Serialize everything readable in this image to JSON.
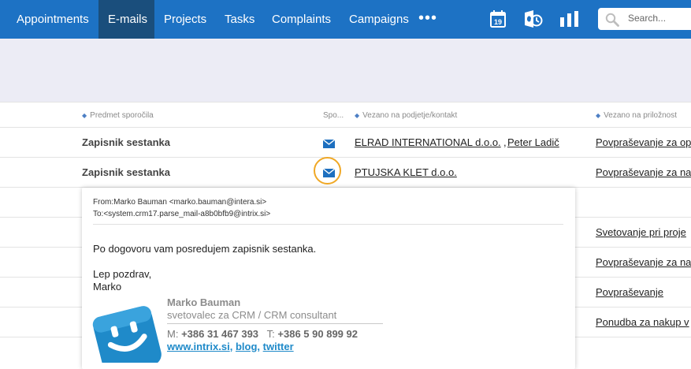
{
  "nav": {
    "items": [
      {
        "label": "Appointments"
      },
      {
        "label": "E-mails",
        "active": true
      },
      {
        "label": "Projects"
      },
      {
        "label": "Tasks"
      },
      {
        "label": "Complaints"
      },
      {
        "label": "Campaigns"
      }
    ],
    "more": "•••",
    "calendar_day": "19",
    "icons": [
      "more-dots-icon",
      "calendar-icon",
      "outlook-sync-icon",
      "bar-chart-icon",
      "search-icon"
    ]
  },
  "search": {
    "placeholder": "Search..."
  },
  "colors": {
    "topbar": "#1d72c4",
    "active_tab": "#1a4e7c",
    "highlight_ring": "#f0a825",
    "link_blue": "#1f8ac9",
    "envelope": "#1d6fbf"
  },
  "table": {
    "headers": {
      "subject": "Predmet sporočila",
      "sent": "Spo...",
      "related": "Vezano na podjetje/kontakt",
      "opportunity": "Vezano na priložnost"
    },
    "rows": [
      {
        "subject": "Zapisnik sestanka",
        "company": "ELRAD INTERNATIONAL d.o.o.",
        "sep": ",",
        "contact": "Peter Ladič",
        "opportunity": "Povpraševanje za op"
      },
      {
        "subject": "Zapisnik sestanka",
        "company": "PTUJSKA KLET d.o.o.",
        "opportunity": "Povpraševanje za na"
      }
    ],
    "opportunities_below": [
      "Svetovanje pri proje",
      "Povpraševanje za na",
      "Povpraševanje",
      "Ponudba za nakup v"
    ]
  },
  "preview": {
    "from": "From:Marko Bauman <marko.bauman@intera.si>",
    "to": "To:<system.crm17.parse_mail-a8b0bfb9@intrix.si>",
    "body": "Po dogovoru vam posredujem zapisnik sestanka.",
    "greeting": "Lep pozdrav,",
    "sender": "Marko",
    "signature": {
      "name": "Marko Bauman",
      "title": "svetovalec za CRM / CRM consultant",
      "mobile_label": "M:",
      "mobile": "+386 31 467 393",
      "phone_label": "T:",
      "phone": "+386 5 90 899 92",
      "website": "www.intrix.si",
      "blog": "blog",
      "twitter": "twitter",
      "comma": ","
    }
  }
}
